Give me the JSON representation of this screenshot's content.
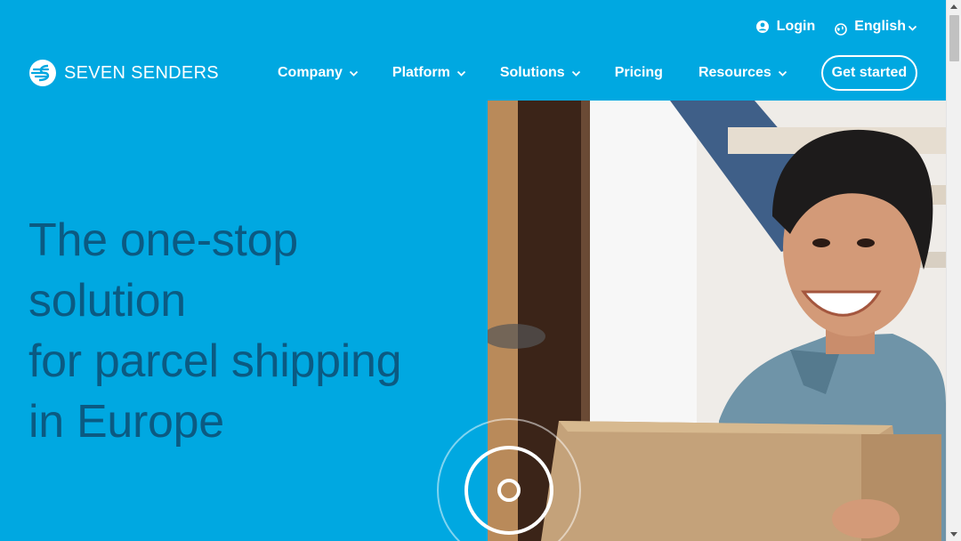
{
  "header": {
    "login_label": "Login",
    "language_label": "English",
    "brand_name": "SEVEN SENDERS"
  },
  "nav": {
    "items": [
      {
        "label": "Company",
        "dropdown": true
      },
      {
        "label": "Platform",
        "dropdown": true
      },
      {
        "label": "Solutions",
        "dropdown": true
      },
      {
        "label": "Pricing",
        "dropdown": false
      },
      {
        "label": "Resources",
        "dropdown": true
      }
    ],
    "cta_label": "Get started"
  },
  "hero": {
    "title_lines": [
      "The one-stop",
      "solution",
      "for parcel shipping",
      "in Europe"
    ]
  },
  "icons": {
    "login": "user-circle-icon",
    "language": "globe-icon",
    "dropdown": "chevron-down-icon",
    "play": "play-circle-icon"
  },
  "colors": {
    "background": "#00a8e1",
    "headline": "#0b5a82",
    "nav_text": "#ffffff"
  }
}
